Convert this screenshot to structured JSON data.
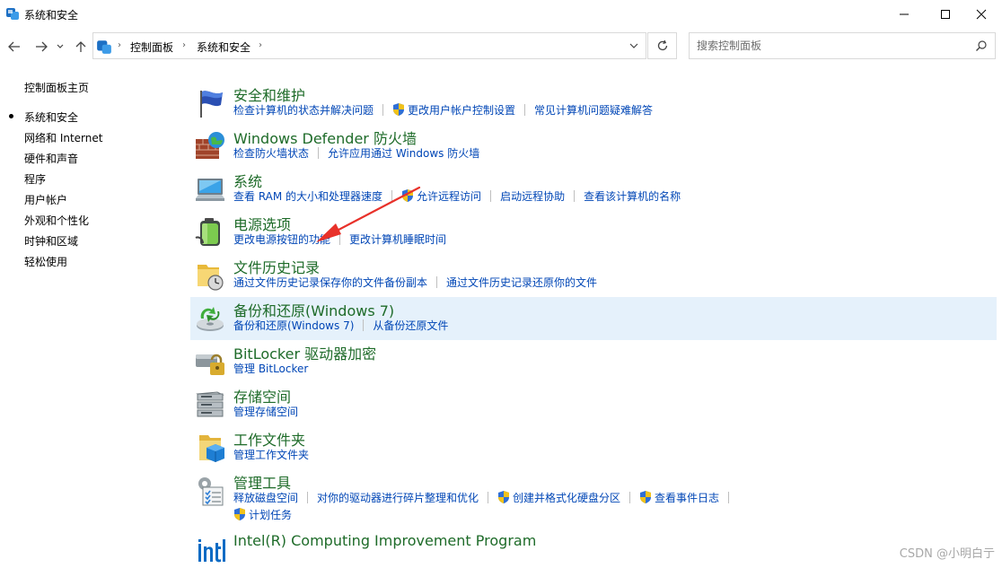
{
  "window": {
    "title": "系统和安全"
  },
  "address": {
    "crumbs": [
      "控制面板",
      "系统和安全"
    ]
  },
  "search": {
    "placeholder": "搜索控制面板"
  },
  "sidebar": {
    "items": [
      {
        "label": "控制面板主页",
        "active": false
      },
      {
        "label": "系统和安全",
        "active": true
      },
      {
        "label": "网络和 Internet",
        "active": false
      },
      {
        "label": "硬件和声音",
        "active": false
      },
      {
        "label": "程序",
        "active": false
      },
      {
        "label": "用户帐户",
        "active": false
      },
      {
        "label": "外观和个性化",
        "active": false
      },
      {
        "label": "时钟和区域",
        "active": false
      },
      {
        "label": "轻松使用",
        "active": false
      }
    ]
  },
  "categories": [
    {
      "title": "安全和维护",
      "icon": "flag-icon",
      "links": [
        "检查计算机的状态并解决问题",
        "更改用户帐户控制设置",
        "常见计算机问题疑难解答"
      ]
    },
    {
      "title": "Windows Defender 防火墙",
      "icon": "firewall-icon",
      "links": [
        "检查防火墙状态",
        "允许应用通过 Windows 防火墙"
      ]
    },
    {
      "title": "系统",
      "icon": "computer-icon",
      "links": [
        "查看 RAM 的大小和处理器速度",
        "允许远程访问",
        "启动远程协助",
        "查看该计算机的名称"
      ]
    },
    {
      "title": "电源选项",
      "icon": "battery-icon",
      "links": [
        "更改电源按钮的功能",
        "更改计算机睡眠时间"
      ]
    },
    {
      "title": "文件历史记录",
      "icon": "file-history-icon",
      "links": [
        "通过文件历史记录保存你的文件备份副本",
        "通过文件历史记录还原你的文件"
      ]
    },
    {
      "title": "备份和还原(Windows 7)",
      "icon": "backup-icon",
      "links": [
        "备份和还原(Windows 7)",
        "从备份还原文件"
      ]
    },
    {
      "title": "BitLocker 驱动器加密",
      "icon": "bitlocker-icon",
      "links": [
        "管理 BitLocker"
      ]
    },
    {
      "title": "存储空间",
      "icon": "storage-icon",
      "links": [
        "管理存储空间"
      ]
    },
    {
      "title": "工作文件夹",
      "icon": "work-folder-icon",
      "links": [
        "管理工作文件夹"
      ]
    },
    {
      "title": "管理工具",
      "icon": "admin-tools-icon",
      "links": [
        "释放磁盘空间",
        "对你的驱动器进行碎片整理和优化",
        "创建并格式化硬盘分区",
        "查看事件日志",
        "计划任务"
      ]
    },
    {
      "title": "Intel(R) Computing Improvement Program",
      "icon": "intel-icon",
      "links": []
    }
  ],
  "watermark": "CSDN @小明白亍",
  "colors": {
    "category_title": "#1e6b29",
    "link": "#0046b6",
    "highlight_row": "#e5f1fb",
    "annotation_arrow": "#e8312a"
  }
}
